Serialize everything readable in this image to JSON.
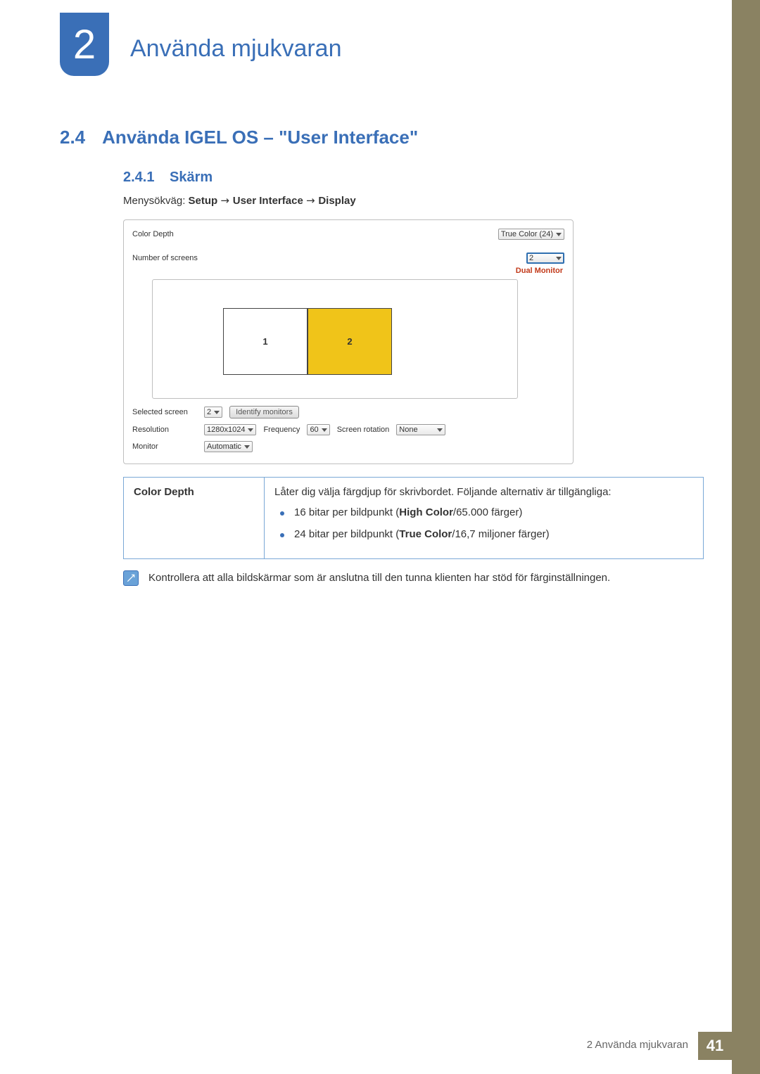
{
  "chapter": {
    "number": "2",
    "title": "Använda mjukvaran"
  },
  "section": {
    "number": "2.4",
    "title": "Använda IGEL OS – \"User Interface\""
  },
  "subsection": {
    "number": "2.4.1",
    "title": "Skärm"
  },
  "menupath": {
    "prefix": "Menysökväg: ",
    "parts": [
      "Setup",
      "User Interface",
      "Display"
    ]
  },
  "panel": {
    "color_depth_label": "Color Depth",
    "color_depth_value": "True Color (24)",
    "num_screens_label": "Number of screens",
    "num_screens_value": "2",
    "dual_monitor_text": "Dual Monitor",
    "monitors": [
      "1",
      "2"
    ],
    "selected_screen_label": "Selected screen",
    "selected_screen_value": "2",
    "identify_button": "Identify monitors",
    "resolution_label": "Resolution",
    "resolution_value": "1280x1024",
    "frequency_label": "Frequency",
    "frequency_value": "60",
    "rotation_label": "Screen rotation",
    "rotation_value": "None",
    "monitor_label": "Monitor",
    "monitor_value": "Automatic"
  },
  "feature": {
    "key": "Color Depth",
    "desc_intro": "Låter dig välja färgdjup för skrivbordet. Följande alternativ är tillgängliga:",
    "bullets": [
      {
        "pre": "16 bitar per bildpunkt (",
        "bold": "High Color",
        "post": "/65.000 färger)"
      },
      {
        "pre": "24 bitar per bildpunkt (",
        "bold": "True Color",
        "post": "/16,7 miljoner färger)"
      }
    ]
  },
  "note": "Kontrollera att alla bildskärmar som är anslutna till den tunna klienten har stöd för färginställningen.",
  "footer": {
    "text": "2 Använda mjukvaran",
    "page": "41"
  }
}
